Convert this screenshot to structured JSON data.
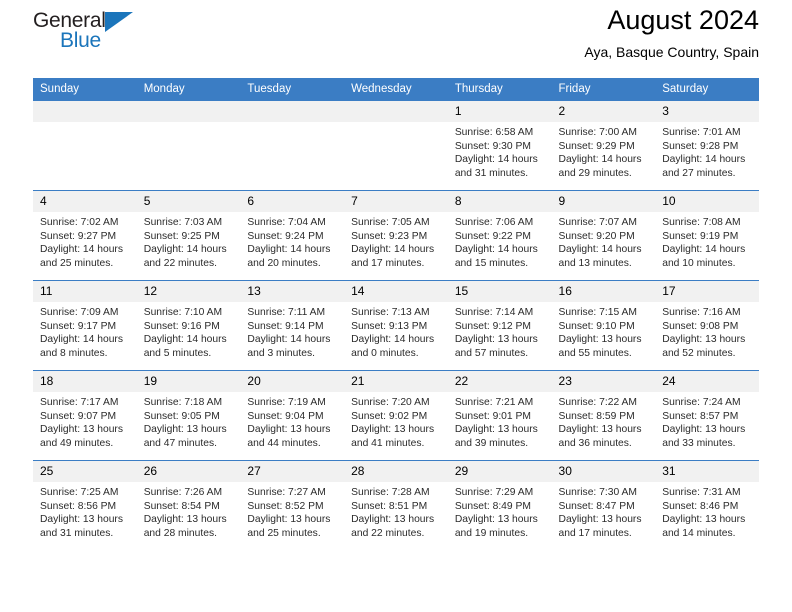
{
  "brand": {
    "word_one": "General",
    "word_two": "Blue",
    "triangle_icon": "triangle-icon",
    "accent_color": "#1b75bb"
  },
  "header": {
    "title": "August 2024",
    "subtitle": "Aya, Basque Country, Spain",
    "header_bg_color": "#3b7dc4",
    "daynum_bg_color": "#f1f1f1"
  },
  "weekdays": [
    "Sunday",
    "Monday",
    "Tuesday",
    "Wednesday",
    "Thursday",
    "Friday",
    "Saturday"
  ],
  "labels": {
    "sunrise_prefix": "Sunrise:",
    "sunset_prefix": "Sunset:",
    "daylight_prefix": "Daylight:"
  },
  "weeks": [
    [
      {
        "day": "",
        "empty": true
      },
      {
        "day": "",
        "empty": true
      },
      {
        "day": "",
        "empty": true
      },
      {
        "day": "",
        "empty": true
      },
      {
        "day": "1",
        "sunrise": "Sunrise: 6:58 AM",
        "sunset": "Sunset: 9:30 PM",
        "daylight": "Daylight: 14 hours and 31 minutes."
      },
      {
        "day": "2",
        "sunrise": "Sunrise: 7:00 AM",
        "sunset": "Sunset: 9:29 PM",
        "daylight": "Daylight: 14 hours and 29 minutes."
      },
      {
        "day": "3",
        "sunrise": "Sunrise: 7:01 AM",
        "sunset": "Sunset: 9:28 PM",
        "daylight": "Daylight: 14 hours and 27 minutes."
      }
    ],
    [
      {
        "day": "4",
        "sunrise": "Sunrise: 7:02 AM",
        "sunset": "Sunset: 9:27 PM",
        "daylight": "Daylight: 14 hours and 25 minutes."
      },
      {
        "day": "5",
        "sunrise": "Sunrise: 7:03 AM",
        "sunset": "Sunset: 9:25 PM",
        "daylight": "Daylight: 14 hours and 22 minutes."
      },
      {
        "day": "6",
        "sunrise": "Sunrise: 7:04 AM",
        "sunset": "Sunset: 9:24 PM",
        "daylight": "Daylight: 14 hours and 20 minutes."
      },
      {
        "day": "7",
        "sunrise": "Sunrise: 7:05 AM",
        "sunset": "Sunset: 9:23 PM",
        "daylight": "Daylight: 14 hours and 17 minutes."
      },
      {
        "day": "8",
        "sunrise": "Sunrise: 7:06 AM",
        "sunset": "Sunset: 9:22 PM",
        "daylight": "Daylight: 14 hours and 15 minutes."
      },
      {
        "day": "9",
        "sunrise": "Sunrise: 7:07 AM",
        "sunset": "Sunset: 9:20 PM",
        "daylight": "Daylight: 14 hours and 13 minutes."
      },
      {
        "day": "10",
        "sunrise": "Sunrise: 7:08 AM",
        "sunset": "Sunset: 9:19 PM",
        "daylight": "Daylight: 14 hours and 10 minutes."
      }
    ],
    [
      {
        "day": "11",
        "sunrise": "Sunrise: 7:09 AM",
        "sunset": "Sunset: 9:17 PM",
        "daylight": "Daylight: 14 hours and 8 minutes."
      },
      {
        "day": "12",
        "sunrise": "Sunrise: 7:10 AM",
        "sunset": "Sunset: 9:16 PM",
        "daylight": "Daylight: 14 hours and 5 minutes."
      },
      {
        "day": "13",
        "sunrise": "Sunrise: 7:11 AM",
        "sunset": "Sunset: 9:14 PM",
        "daylight": "Daylight: 14 hours and 3 minutes."
      },
      {
        "day": "14",
        "sunrise": "Sunrise: 7:13 AM",
        "sunset": "Sunset: 9:13 PM",
        "daylight": "Daylight: 14 hours and 0 minutes."
      },
      {
        "day": "15",
        "sunrise": "Sunrise: 7:14 AM",
        "sunset": "Sunset: 9:12 PM",
        "daylight": "Daylight: 13 hours and 57 minutes."
      },
      {
        "day": "16",
        "sunrise": "Sunrise: 7:15 AM",
        "sunset": "Sunset: 9:10 PM",
        "daylight": "Daylight: 13 hours and 55 minutes."
      },
      {
        "day": "17",
        "sunrise": "Sunrise: 7:16 AM",
        "sunset": "Sunset: 9:08 PM",
        "daylight": "Daylight: 13 hours and 52 minutes."
      }
    ],
    [
      {
        "day": "18",
        "sunrise": "Sunrise: 7:17 AM",
        "sunset": "Sunset: 9:07 PM",
        "daylight": "Daylight: 13 hours and 49 minutes."
      },
      {
        "day": "19",
        "sunrise": "Sunrise: 7:18 AM",
        "sunset": "Sunset: 9:05 PM",
        "daylight": "Daylight: 13 hours and 47 minutes."
      },
      {
        "day": "20",
        "sunrise": "Sunrise: 7:19 AM",
        "sunset": "Sunset: 9:04 PM",
        "daylight": "Daylight: 13 hours and 44 minutes."
      },
      {
        "day": "21",
        "sunrise": "Sunrise: 7:20 AM",
        "sunset": "Sunset: 9:02 PM",
        "daylight": "Daylight: 13 hours and 41 minutes."
      },
      {
        "day": "22",
        "sunrise": "Sunrise: 7:21 AM",
        "sunset": "Sunset: 9:01 PM",
        "daylight": "Daylight: 13 hours and 39 minutes."
      },
      {
        "day": "23",
        "sunrise": "Sunrise: 7:22 AM",
        "sunset": "Sunset: 8:59 PM",
        "daylight": "Daylight: 13 hours and 36 minutes."
      },
      {
        "day": "24",
        "sunrise": "Sunrise: 7:24 AM",
        "sunset": "Sunset: 8:57 PM",
        "daylight": "Daylight: 13 hours and 33 minutes."
      }
    ],
    [
      {
        "day": "25",
        "sunrise": "Sunrise: 7:25 AM",
        "sunset": "Sunset: 8:56 PM",
        "daylight": "Daylight: 13 hours and 31 minutes."
      },
      {
        "day": "26",
        "sunrise": "Sunrise: 7:26 AM",
        "sunset": "Sunset: 8:54 PM",
        "daylight": "Daylight: 13 hours and 28 minutes."
      },
      {
        "day": "27",
        "sunrise": "Sunrise: 7:27 AM",
        "sunset": "Sunset: 8:52 PM",
        "daylight": "Daylight: 13 hours and 25 minutes."
      },
      {
        "day": "28",
        "sunrise": "Sunrise: 7:28 AM",
        "sunset": "Sunset: 8:51 PM",
        "daylight": "Daylight: 13 hours and 22 minutes."
      },
      {
        "day": "29",
        "sunrise": "Sunrise: 7:29 AM",
        "sunset": "Sunset: 8:49 PM",
        "daylight": "Daylight: 13 hours and 19 minutes."
      },
      {
        "day": "30",
        "sunrise": "Sunrise: 7:30 AM",
        "sunset": "Sunset: 8:47 PM",
        "daylight": "Daylight: 13 hours and 17 minutes."
      },
      {
        "day": "31",
        "sunrise": "Sunrise: 7:31 AM",
        "sunset": "Sunset: 8:46 PM",
        "daylight": "Daylight: 13 hours and 14 minutes."
      }
    ]
  ]
}
